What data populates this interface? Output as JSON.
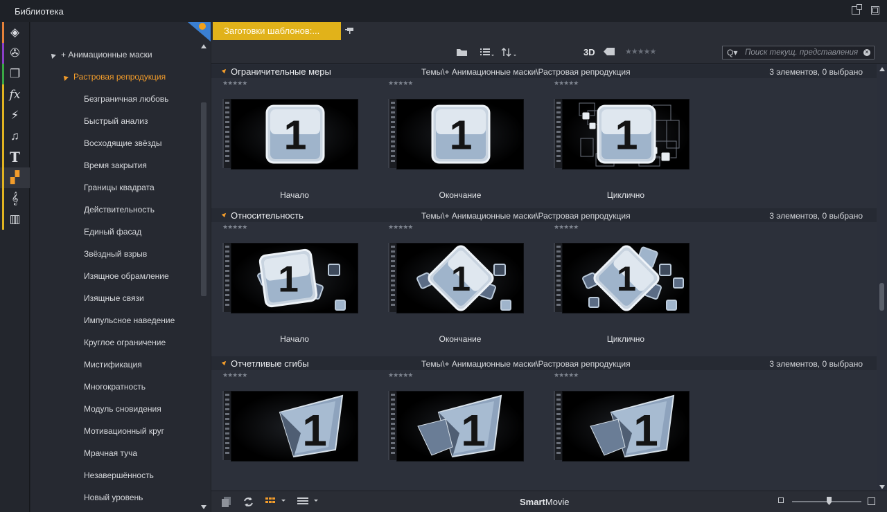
{
  "window": {
    "title": "Библиотека"
  },
  "rail": {
    "items": [
      {
        "name": "project-bins-icon",
        "glyph": "◈",
        "stripe": "#e5813a"
      },
      {
        "name": "film-reel-icon",
        "glyph": "✇",
        "stripe": "#8a3fc8"
      },
      {
        "name": "clips-icon",
        "glyph": "❐",
        "stripe": "#3aa845"
      },
      {
        "name": "effects-icon",
        "glyph": "fx",
        "stripe": "#e0b321"
      },
      {
        "name": "transitions-icon",
        "glyph": "⚡",
        "stripe": "#e0b321"
      },
      {
        "name": "music-icon",
        "glyph": "♫",
        "stripe": "#e0b321"
      },
      {
        "name": "titles-icon",
        "glyph": "T",
        "stripe": "#e0b321"
      },
      {
        "name": "templates-icon",
        "glyph": "▞",
        "stripe": "#e0b321"
      },
      {
        "name": "score-icon",
        "glyph": "𝄞",
        "stripe": "#e0b321"
      },
      {
        "name": "piano-icon",
        "glyph": "▥",
        "stripe": "#e0b321"
      }
    ]
  },
  "tree": {
    "parent": "+ Анимационные маски",
    "selected": "Растровая репродукция",
    "items": [
      "Безграничная любовь",
      "Быстрый анализ",
      "Восходящие звёзды",
      "Время закрытия",
      "Границы квадрата",
      "Действительность",
      "Единый фасад",
      "Звёздный взрыв",
      "Изящное обрамление",
      "Изящные связи",
      "Импульсное наведение",
      "Круглое ограничение",
      "Мистификация",
      "Многократность",
      "Модуль сновидения",
      "Мотивационный круг",
      "Мрачная туча",
      "Незавершённость",
      "Новый уровень"
    ]
  },
  "tabs": {
    "active": "Заготовки шаблонов:..."
  },
  "toolbar": {
    "view3d": "3D",
    "stars": "★★★★★",
    "search_placeholder": "Поиск текущ. представления"
  },
  "sections": [
    {
      "title": "Ограничительные меры",
      "path": "Темы\\+ Анимационные маски\\Растровая репродукция",
      "count": "3 элементов, 0 выбрано",
      "items": [
        "Начало",
        "Окончание",
        "Циклично"
      ]
    },
    {
      "title": "Относительность",
      "path": "Темы\\+ Анимационные маски\\Растровая репродукция",
      "count": "3 элементов, 0 выбрано",
      "items": [
        "Начало",
        "Окончание",
        "Циклично"
      ]
    },
    {
      "title": "Отчетливые сгибы",
      "path": "Темы\\+ Анимационные маски\\Растровая репродукция",
      "count": "3 элементов, 0 выбрано",
      "items": []
    }
  ],
  "thumb_number": "1",
  "rating_stars": "★★★★★",
  "statusbar": {
    "brand_bold": "Smart",
    "brand_rest": "Movie"
  },
  "colors": {
    "accent": "#e1b21a",
    "selection": "#f29c2b",
    "pin": "#3a7fd2"
  }
}
